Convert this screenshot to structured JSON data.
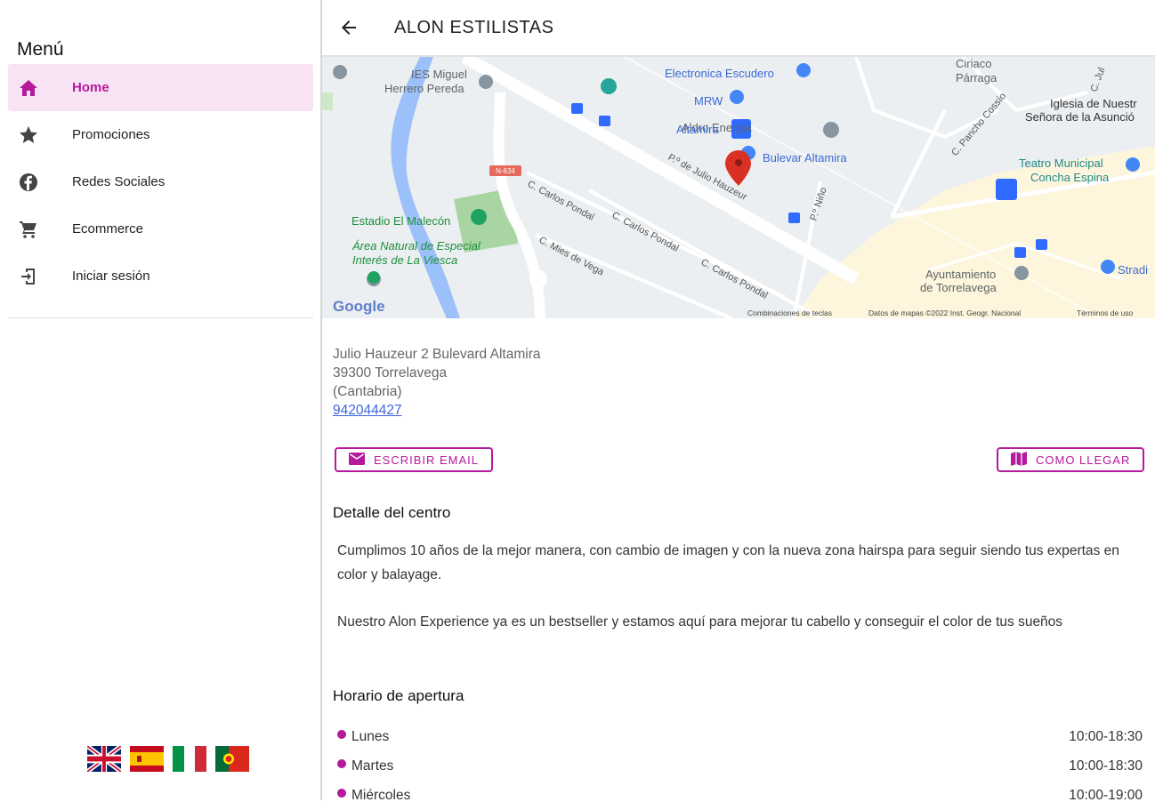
{
  "sidebar": {
    "title": "Menú",
    "items": [
      {
        "label": "Home",
        "icon": "home-icon"
      },
      {
        "label": "Promociones",
        "icon": "star-icon"
      },
      {
        "label": "Redes Sociales",
        "icon": "facebook-icon"
      },
      {
        "label": "Ecommerce",
        "icon": "cart-icon"
      },
      {
        "label": "Iniciar sesión",
        "icon": "login-icon"
      }
    ],
    "flags": [
      "uk-flag-icon",
      "spain-flag-icon",
      "italy-flag-icon",
      "portugal-flag-icon"
    ]
  },
  "header": {
    "title": "ALON ESTILISTAS"
  },
  "map": {
    "labels": {
      "ies": "IES Miguel",
      "ies2": "Herrero Pereda",
      "electronica": "Electronica Escudero",
      "mrw": "MRW",
      "altamira": "Altamira",
      "aldro": "Aldro Energia",
      "bulevar": "Bulevar Altamira",
      "ciriaco": "Ciriaco",
      "parraga": "Párraga",
      "iglesia": "Iglesia de Nuestr",
      "iglesia2": "Señora de la Asunció",
      "teatro": "Teatro Municipal",
      "teatro2": "Concha Espina",
      "stadium": "Estadio El Malecón",
      "area1": "Área Natural de Especial",
      "area2": "Interés de La Viesca",
      "ayto": "Ayuntamiento",
      "ayto2": "de Torrelavega",
      "julio": "P.º de Julio Hauzeur",
      "carlos1": "C. Carlos Pondal",
      "carlos2": "C. Carlos Pondal",
      "carlos3": "C. Carlos Pondal",
      "mies": "C. Mies de Vega",
      "ninio": "P.º Niño",
      "pancho": "C. Pancho Cossío",
      "road": "N-634",
      "stradi": "Stradi",
      "c_ju": "C. Jul",
      "google": "Google",
      "footer1": "Combinaciones de teclas",
      "footer2": "Datos de mapas ©2022 Inst. Geogr. Nacional",
      "footer3": "Términos de uso"
    }
  },
  "address": {
    "line1": "Julio Hauzeur 2 Bulevard Altamira",
    "line2": "39300 Torrelavega",
    "line3": "(Cantabria)",
    "phone": "942044427"
  },
  "buttons": {
    "email": "ESCRIBIR EMAIL",
    "route": "COMO LLEGAR"
  },
  "detail": {
    "title": "Detalle del centro",
    "p1": "Cumplimos 10 años de la mejor manera, con cambio de imagen y con la nueva zona hairspa para seguir siendo tus expertas en color y balayage.",
    "p2": "Nuestro Alon Experience ya es un bestseller y estamos aquí para mejorar tu cabello y conseguir el color de tus sueños"
  },
  "hours": {
    "title": "Horario de apertura",
    "rows": [
      {
        "day": "Lunes",
        "time": "10:00-18:30"
      },
      {
        "day": "Martes",
        "time": "10:00-18:30"
      },
      {
        "day": "Miércoles",
        "time": "10:00-19:00"
      }
    ]
  },
  "colors": {
    "accent": "#b5199c",
    "active_bg": "#f7e3f3",
    "link": "#3f64e0"
  }
}
